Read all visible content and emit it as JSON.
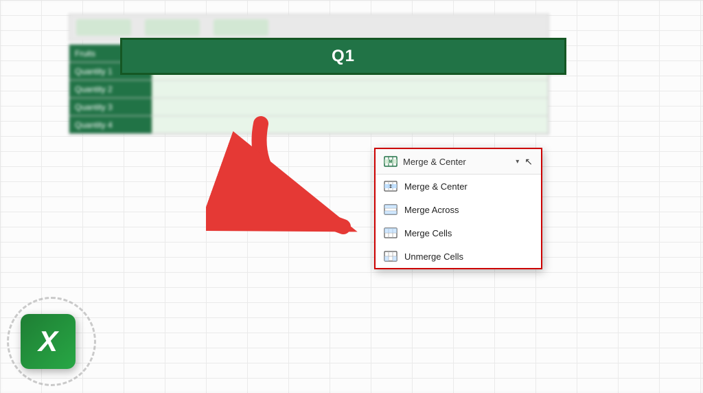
{
  "nameBox": {
    "label": "Q1"
  },
  "toolbar": {
    "mergeButton": "Merge & Center",
    "dropdownArrow": "▾",
    "cursor": "↖"
  },
  "dropdown": {
    "header": {
      "label": "Merge & Center",
      "arrow": "▾"
    },
    "items": [
      {
        "id": "merge-center",
        "label": "Merge & Center"
      },
      {
        "id": "merge-across",
        "label": "Merge Across"
      },
      {
        "id": "merge-cells",
        "label": "Merge Cells"
      },
      {
        "id": "unmerge-cells",
        "label": "Unmerge Cells"
      }
    ]
  },
  "logo": {
    "letter": "X"
  },
  "sheet": {
    "rows": [
      {
        "header": "Fruits",
        "value": ""
      },
      {
        "header": "Quantity 1",
        "value": ""
      },
      {
        "header": "Quantity 2",
        "value": ""
      },
      {
        "header": "Quantity 3",
        "value": ""
      },
      {
        "header": "Quantity 4",
        "value": ""
      }
    ]
  }
}
